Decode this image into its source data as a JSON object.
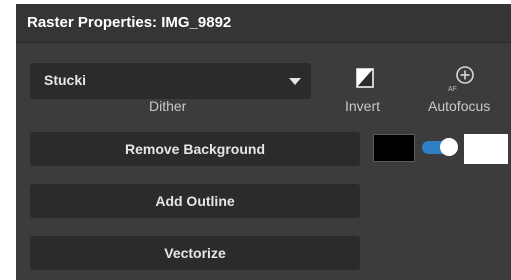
{
  "panel": {
    "title": "Raster Properties: IMG_9892"
  },
  "dither": {
    "selected": "Stucki",
    "label": "Dither"
  },
  "invert": {
    "label": "Invert",
    "icon": "invert-icon"
  },
  "autofocus": {
    "label": "Autofocus",
    "icon": "autofocus-crosshair-icon",
    "icon_text": "AF"
  },
  "buttons": {
    "remove_background": "Remove Background",
    "add_outline": "Add Outline",
    "vectorize": "Vectorize"
  },
  "colors": {
    "swatch_left": "#000000",
    "swatch_right": "#ffffff",
    "toggle_accent": "#2f7fc7",
    "toggle_on": true
  }
}
